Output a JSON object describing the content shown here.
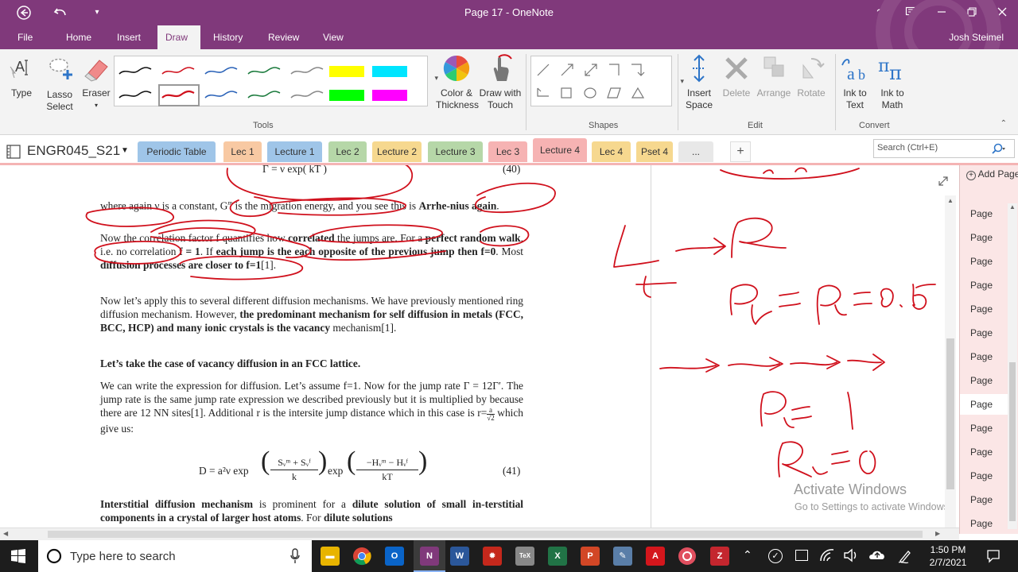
{
  "window": {
    "title": "Page 17 - OneNote",
    "help": "?",
    "user": "Josh Steimel"
  },
  "menu": [
    "File",
    "Home",
    "Insert",
    "Draw",
    "History",
    "Review",
    "View"
  ],
  "ribbon": {
    "type": "Type",
    "lasso_1": "Lasso",
    "lasso_2": "Select",
    "eraser": "Eraser",
    "color_1": "Color &",
    "color_2": "Thickness",
    "draw_1": "Draw with",
    "draw_2": "Touch",
    "tools_label": "Tools",
    "shapes_label": "Shapes",
    "insert_1": "Insert",
    "insert_2": "Space",
    "delete": "Delete",
    "arrange": "Arrange",
    "rotate": "Rotate",
    "edit_label": "Edit",
    "ink_text_1": "Ink to",
    "ink_text_2": "Text",
    "ink_math_1": "Ink to",
    "ink_math_2": "Math",
    "convert_label": "Convert"
  },
  "notebook": {
    "name": "ENGR045_S21",
    "sections": [
      "Periodic Table",
      "Lec 1",
      "Lecture 1",
      "Lec 2",
      "Lecture 2",
      "Lecture 3",
      "Lec 3",
      "Lecture 4",
      "Lec 4",
      "Pset 4",
      "..."
    ],
    "section_colors": [
      "#9fc5e8",
      "#f8c9a3",
      "#9fc5e8",
      "#b6d7a8",
      "#f6d88f",
      "#b6d7a8",
      "#f6b3b3",
      "#f6b3b3",
      "#f6d88f",
      "#f6d88f",
      "#e8e8e8"
    ],
    "add_section": "+",
    "search_placeholder": "Search (Ctrl+E)"
  },
  "doc": {
    "eq40": "Γ = ν exp(   kT   )",
    "eq40_num": "(40)",
    "p1a": "where again ν is a constant, G",
    "p1_sup": "m",
    "p1b": " is the migration energy, and you see this is ",
    "p1_bold": "Arrhe-nius again",
    "p1_end": ".",
    "p2a": "Now the correlation factor f quantifies how ",
    "p2_b1": "correlated",
    "p2b": " the jumps are. For a ",
    "p2_b2": "perfect random walk",
    "p2c": ", i.e. no correlation ",
    "p2_b3": "f = 1",
    "p2d": ". If ",
    "p2_b4": "each jump is the each opposite of the previous jump then f=0",
    "p2e": ". Most ",
    "p2_b5": "diffusion processes are closer to f=1",
    "p2f": "[1].",
    "p3a": "Now let’s apply this to several different diffusion mechanisms. We have previously mentioned ring diffusion mechanism. However, ",
    "p3_b1": "the predominant mechanism for self diffusion in metals (FCC, BCC, HCP) and many ionic crystals is the vacancy",
    "p3b": " mechanism[1].",
    "p4": "Let’s take the case of vacancy diffusion in an FCC lattice.",
    "p5a": "We can write the expression for diffusion. Let’s assume f=1. Now for the jump rate Γ = 12Γ′. The jump rate is the same jump rate expression we described previously but it is multiplied by because there are 12 NN sites[1]. Additional r is the intersite jump distance which in this case is r=",
    "p5_frac_num": "a",
    "p5_frac_den": "√2",
    "p5b": " which give us:",
    "eq41": "D = a²ν exp",
    "eq41_f1_num": "Sᵥᵐ + Sᵥᶠ",
    "eq41_f1_den": "k",
    "eq41_mid": "exp",
    "eq41_f2_num": "−Hᵥᵐ − Hᵥᶠ",
    "eq41_f2_den": "kT",
    "eq41_num": "(41)",
    "p6_b1": "Interstitial diffusion mechanism",
    "p6a": " is prominent for a ",
    "p6_b2": "dilute solution of small in-terstitial components in a crystal of larger host atoms",
    "p6b": ". For ",
    "p6_b3": "dilute solutions"
  },
  "watermark": {
    "line1": "Activate Windows",
    "line2": "Go to Settings to activate Windows."
  },
  "pages": {
    "add_page": "Add Page",
    "items": [
      "Page",
      "Page",
      "Page",
      "Page",
      "Page",
      "Page",
      "Page",
      "Page",
      "Page",
      "Page",
      "Page",
      "Page",
      "Page",
      "Page"
    ],
    "active_index": 8
  },
  "taskbar": {
    "search_placeholder": "Type here to search",
    "time": "1:50 PM",
    "date": "2/7/2021"
  },
  "colors": {
    "onenote_purple": "#80397b",
    "ink_red": "#d0101c"
  }
}
